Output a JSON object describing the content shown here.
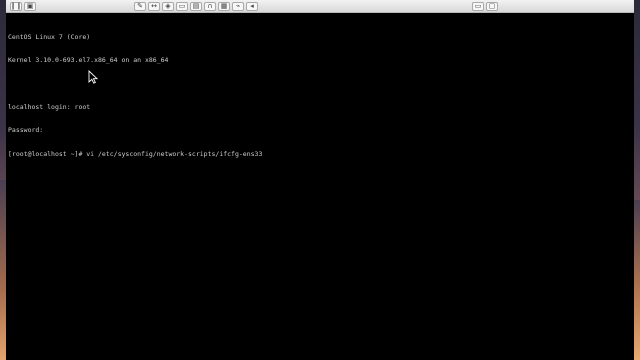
{
  "toolbar": {
    "buttons_left": [
      {
        "name": "pause-icon",
        "glyph": "❙❙"
      },
      {
        "name": "snapshot-icon",
        "glyph": "▣"
      }
    ],
    "buttons_mid": [
      {
        "name": "wrench-icon",
        "glyph": "✎"
      },
      {
        "name": "resize-icon",
        "glyph": "↔"
      },
      {
        "name": "disk-icon",
        "glyph": "◈"
      },
      {
        "name": "drive-icon",
        "glyph": "▭"
      },
      {
        "name": "floppy-icon",
        "glyph": "▤"
      },
      {
        "name": "headphones-icon",
        "glyph": "∩"
      },
      {
        "name": "printer-icon",
        "glyph": "▦"
      },
      {
        "name": "usb-icon",
        "glyph": "⌁"
      },
      {
        "name": "back-icon",
        "glyph": "◂"
      }
    ],
    "buttons_right": [
      {
        "name": "display-icon",
        "glyph": "▭"
      },
      {
        "name": "window-icon",
        "glyph": "▢"
      }
    ]
  },
  "terminal": {
    "lines": [
      "CentOS Linux 7 (Core)",
      "Kernel 3.10.0-693.el7.x86_64 on an x86_64",
      "",
      "localhost login: root",
      "Password:",
      "[root@localhost ~]# vi /etc/sysconfig/network-scripts/ifcfg-ens33"
    ]
  }
}
